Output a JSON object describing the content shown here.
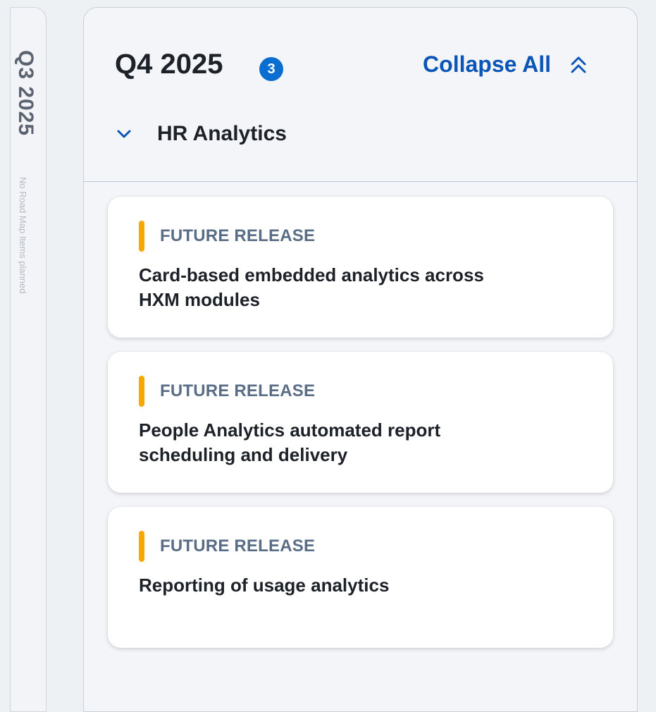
{
  "left_column": {
    "title": "Q3 2025",
    "subtitle": "No Road Map Items planned"
  },
  "column": {
    "title": "Q4 2025",
    "count": "3",
    "collapse_all_label": "Collapse All",
    "group_label": "HR Analytics",
    "cards": [
      {
        "status": "FUTURE RELEASE",
        "title": "Card-based embedded analytics across HXM modules"
      },
      {
        "status": "FUTURE RELEASE",
        "title": "People Analytics automated report scheduling and delivery"
      },
      {
        "status": "FUTURE RELEASE",
        "title": "Reporting of usage analytics"
      }
    ]
  },
  "colors": {
    "accent": "#0a6ed1",
    "link": "#0a55b8",
    "status_bar": "#f6a800",
    "status_text": "#5a6d86"
  },
  "icons": {
    "collapse_all": "double-chevron-up-icon",
    "group_toggle": "chevron-down-icon"
  }
}
